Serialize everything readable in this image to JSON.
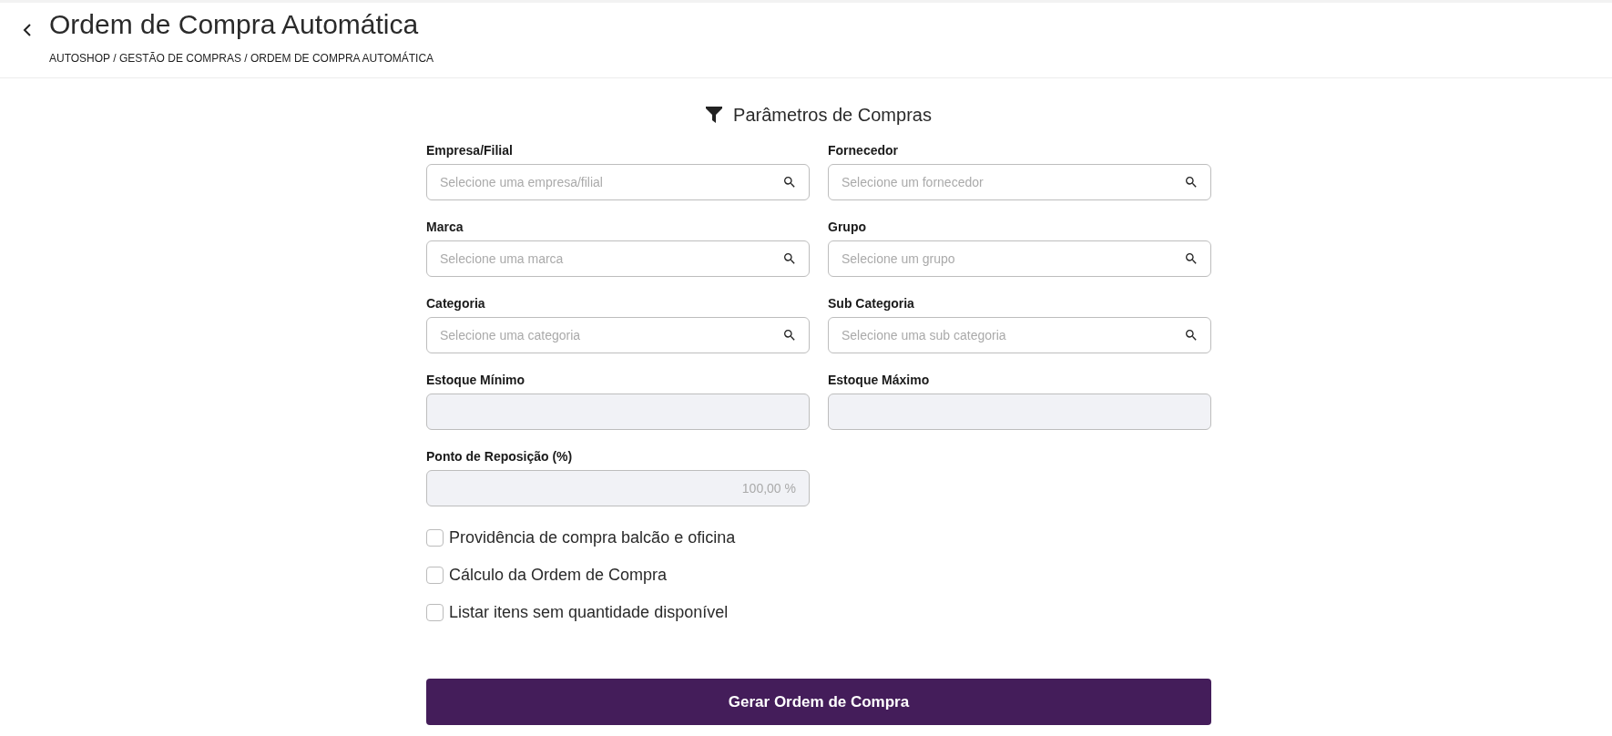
{
  "header": {
    "title": "Ordem de Compra Automática",
    "breadcrumb": "AUTOSHOP / GESTÃO DE COMPRAS / ORDEM DE COMPRA AUTOMÁTICA"
  },
  "section": {
    "title": "Parâmetros de Compras"
  },
  "fields": [
    {
      "label": "Empresa/Filial",
      "kind": "search",
      "placeholder": "Selecione uma empresa/filial",
      "disabled": false
    },
    {
      "label": "Fornecedor",
      "kind": "search",
      "placeholder": "Selecione um fornecedor",
      "disabled": false
    },
    {
      "label": "Marca",
      "kind": "search",
      "placeholder": "Selecione uma marca",
      "disabled": false
    },
    {
      "label": "Grupo",
      "kind": "search",
      "placeholder": "Selecione um grupo",
      "disabled": false
    },
    {
      "label": "Categoria",
      "kind": "search",
      "placeholder": "Selecione uma categoria",
      "disabled": false
    },
    {
      "label": "Sub Categoria",
      "kind": "search",
      "placeholder": "Selecione uma sub categoria",
      "disabled": false
    },
    {
      "label": "Estoque Mínimo",
      "kind": "text",
      "disabled": true
    },
    {
      "label": "Estoque Máximo",
      "kind": "text",
      "disabled": true
    },
    {
      "label": "Ponto de Reposição (%)",
      "kind": "number",
      "value": "100,00 %",
      "disabled": true
    }
  ],
  "options": [
    {
      "label": "Providência de compra balcão e oficina",
      "checked": false
    },
    {
      "label": "Cálculo da Ordem de Compra",
      "checked": false
    },
    {
      "label": "Listar itens sem quantidade disponível",
      "checked": false
    }
  ],
  "submit": {
    "label": "Gerar Ordem de Compra"
  }
}
